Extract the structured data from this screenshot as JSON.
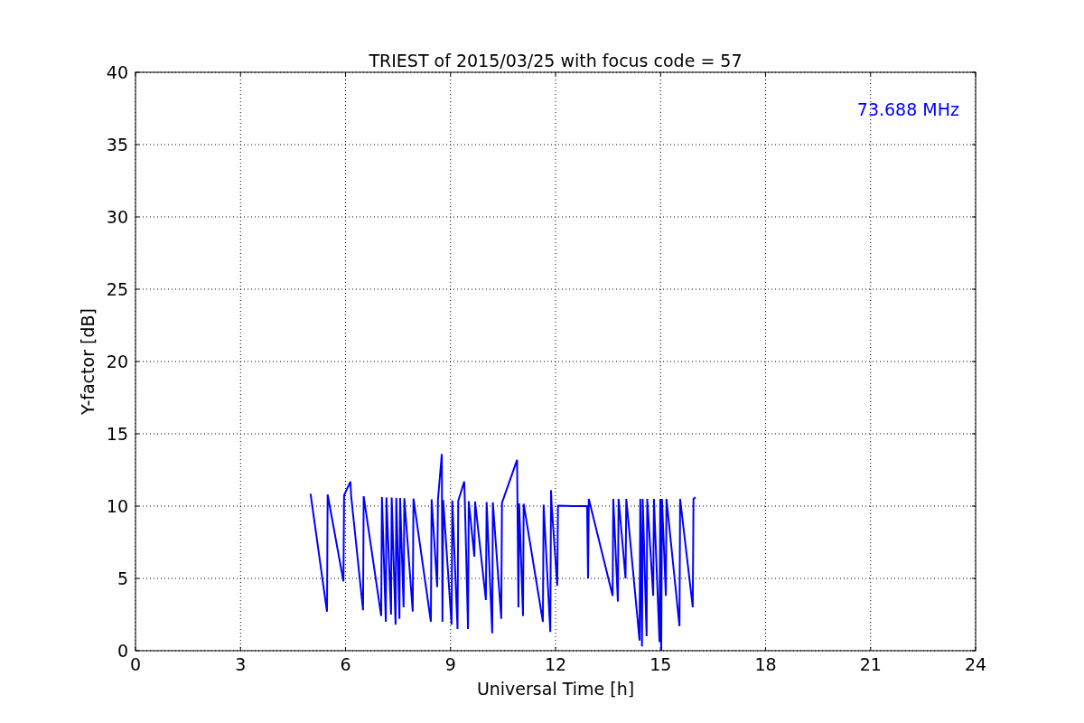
{
  "chart_data": {
    "type": "line",
    "title": "TRIEST of 2015/03/25 with focus code = 57",
    "xlabel": "Universal Time [h]",
    "ylabel": "Y-factor [dB]",
    "xlim": [
      0,
      24
    ],
    "ylim": [
      0,
      40
    ],
    "xticks": [
      0,
      3,
      6,
      9,
      12,
      15,
      18,
      21,
      24
    ],
    "yticks": [
      0,
      5,
      10,
      15,
      20,
      25,
      30,
      35,
      40
    ],
    "x": [
      5.0,
      5.47,
      5.49,
      5.94,
      5.96,
      6.14,
      6.16,
      6.5,
      6.52,
      7.02,
      7.04,
      7.15,
      7.17,
      7.3,
      7.32,
      7.43,
      7.45,
      7.54,
      7.56,
      7.66,
      7.68,
      7.92,
      7.94,
      8.44,
      8.46,
      8.62,
      8.64,
      8.75,
      8.77,
      8.79,
      9.03,
      9.05,
      9.2,
      9.22,
      9.39,
      9.41,
      9.5,
      9.52,
      9.68,
      9.7,
      10.01,
      10.03,
      10.19,
      10.21,
      10.45,
      10.47,
      10.9,
      10.94,
      10.96,
      11.07,
      11.09,
      11.64,
      11.66,
      11.85,
      11.87,
      11.89,
      12.05,
      12.07,
      12.5,
      12.9,
      12.93,
      12.95,
      13.63,
      13.65,
      13.78,
      13.8,
      14.0,
      14.02,
      14.4,
      14.42,
      14.47,
      14.49,
      14.6,
      14.62,
      14.79,
      14.81,
      14.97,
      14.99,
      15.02,
      15.04,
      15.15,
      15.17,
      15.54,
      15.56,
      15.92,
      15.94,
      16.0
    ],
    "series": [
      {
        "name": "73.688 MHz",
        "color": "#0000ff",
        "values": [
          10.85,
          2.7,
          10.8,
          4.8,
          10.75,
          11.7,
          10.72,
          2.8,
          10.68,
          2.4,
          10.62,
          2.0,
          10.6,
          2.5,
          10.59,
          1.8,
          10.57,
          2.2,
          10.56,
          3.0,
          10.55,
          2.7,
          10.52,
          2.0,
          10.46,
          4.4,
          10.44,
          13.6,
          2.0,
          10.42,
          1.8,
          10.39,
          1.5,
          10.37,
          11.7,
          10.35,
          1.5,
          10.34,
          6.5,
          10.32,
          3.5,
          10.28,
          1.2,
          10.26,
          2.2,
          10.23,
          13.2,
          3.0,
          10.18,
          2.4,
          10.16,
          2.0,
          10.1,
          1.3,
          11.1,
          10.06,
          4.5,
          10.03,
          10.0,
          10.0,
          5.0,
          10.5,
          3.8,
          10.5,
          3.4,
          10.5,
          5.0,
          10.5,
          0.7,
          10.5,
          0.3,
          10.5,
          1.0,
          10.5,
          3.8,
          10.5,
          0.6,
          10.5,
          0,
          10.5,
          3.8,
          10.5,
          1.7,
          10.5,
          3.0,
          10.5,
          10.6
        ]
      }
    ],
    "grid": true
  }
}
